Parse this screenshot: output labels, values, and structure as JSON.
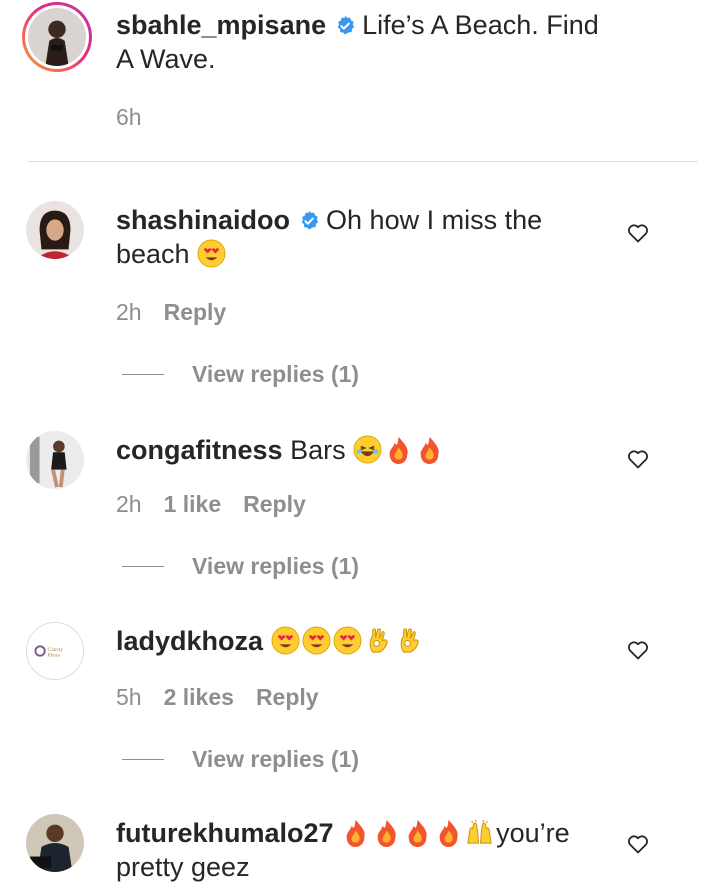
{
  "caption": {
    "username": "sbahle_mpisane",
    "text": "Life’s A Beach. Find A Wave.",
    "time": "6h",
    "verified": true
  },
  "comments": [
    {
      "username": "shashinaidoo",
      "verified": true,
      "text": "Oh how I miss the beach",
      "emojis": [
        "heart-eyes"
      ],
      "time": "2h",
      "likes": "",
      "reply": "Reply",
      "view_replies": "View replies (1)"
    },
    {
      "username": "congafitness",
      "verified": false,
      "text": "Bars",
      "emojis": [
        "laughing",
        "fire",
        "fire"
      ],
      "time": "2h",
      "likes": "1 like",
      "reply": "Reply",
      "view_replies": "View replies (1)"
    },
    {
      "username": "ladydkhoza",
      "verified": false,
      "text": "",
      "emojis": [
        "heart-eyes",
        "heart-eyes",
        "heart-eyes",
        "ok-hand",
        "ok-hand"
      ],
      "time": "5h",
      "likes": "2 likes",
      "reply": "Reply",
      "view_replies": "View replies (1)"
    },
    {
      "username": "futurekhumalo27",
      "verified": false,
      "text": "you’re pretty geez",
      "emojis": [
        "fire",
        "fire",
        "fire",
        "fire",
        "raising-hands"
      ],
      "time": "",
      "likes": "",
      "reply": "",
      "view_replies": ""
    }
  ],
  "colors": {
    "text": "#262626",
    "muted": "#8e8e8e",
    "verified": "#3897f0",
    "divider": "#dbdbdb"
  }
}
